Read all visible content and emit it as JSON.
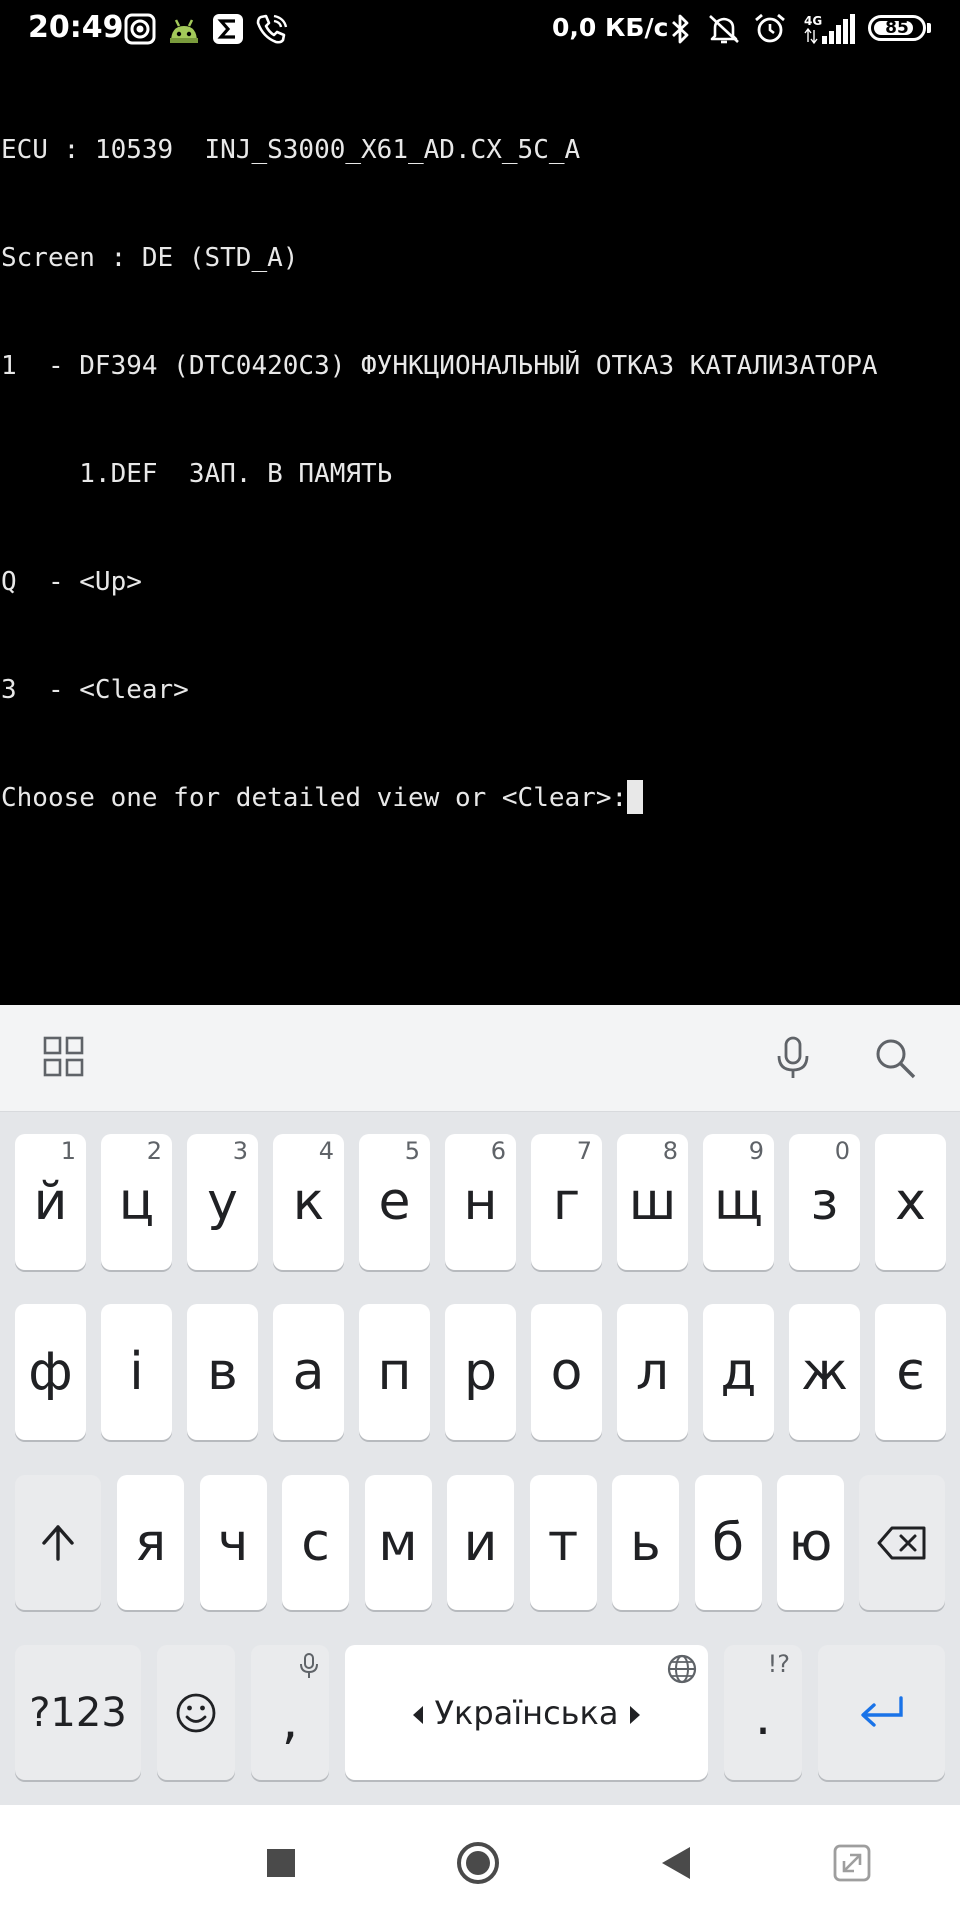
{
  "status_bar": {
    "time": "20:49",
    "network_speed": "0,0 КБ/с",
    "network_type": "4G",
    "battery_level": "85",
    "icons": [
      "screen-record-icon",
      "android-icon",
      "sigma-icon",
      "wifi-calling-icon",
      "bluetooth-icon",
      "mute-icon",
      "alarm-icon",
      "signal-icon"
    ]
  },
  "terminal": {
    "lines": [
      "ECU : 10539  INJ_S3000_X61_AD.CX_5C_A",
      "Screen : DE (STD_A)",
      "1  - DF394 (DTC0420C3) ФУНКЦИОНАЛЬНЫЙ ОТКАЗ КАТАЛИЗАТОРА",
      "     1.DEF  ЗАП. В ПАМЯТЬ",
      "Q  - <Up>",
      "3  - <Clear>",
      "Choose one for detailed view or <Clear>:"
    ]
  },
  "keyboard": {
    "toolbar_icons": [
      "apps-grid-icon",
      "microphone-icon",
      "search-icon"
    ],
    "row1": [
      {
        "char": "й",
        "hint": "1"
      },
      {
        "char": "ц",
        "hint": "2"
      },
      {
        "char": "у",
        "hint": "3"
      },
      {
        "char": "к",
        "hint": "4"
      },
      {
        "char": "е",
        "hint": "5"
      },
      {
        "char": "н",
        "hint": "6"
      },
      {
        "char": "г",
        "hint": "7"
      },
      {
        "char": "ш",
        "hint": "8"
      },
      {
        "char": "щ",
        "hint": "9"
      },
      {
        "char": "з",
        "hint": "0"
      },
      {
        "char": "х",
        "hint": ""
      }
    ],
    "row2": [
      "ф",
      "і",
      "в",
      "а",
      "п",
      "р",
      "о",
      "л",
      "д",
      "ж",
      "є"
    ],
    "row3": [
      "я",
      "ч",
      "с",
      "м",
      "и",
      "т",
      "ь",
      "б",
      "ю"
    ],
    "symbols_label": "?123",
    "comma_label": ",",
    "space_label": "Українська",
    "period_label": ".",
    "period_hint": "!?",
    "accent_color": "#1a73e8"
  },
  "nav_bar": {
    "icons": [
      "recents-square-icon",
      "home-circle-icon",
      "back-triangle-icon",
      "screen-expand-icon"
    ]
  }
}
